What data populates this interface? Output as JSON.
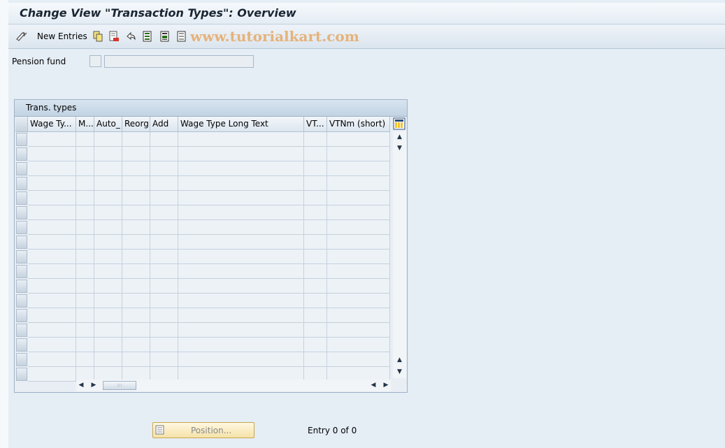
{
  "window": {
    "title": "Change View \"Transaction Types\": Overview"
  },
  "toolbar": {
    "new_entries_label": "New Entries",
    "icons": [
      "display-change-icon",
      "copy-icon",
      "delete-icon",
      "undo-icon",
      "select-all-icon",
      "select-block-icon",
      "deselect-all-icon"
    ],
    "watermark": "www.tutorialkart.com"
  },
  "filter": {
    "pension_fund_label": "Pension fund",
    "pension_fund_key": "",
    "pension_fund_text": ""
  },
  "table": {
    "title": "Trans. types",
    "columns": [
      "Wage Ty...",
      "M...",
      "Auto_",
      "Reorg",
      "Add",
      "Wage Type Long Text",
      "VT...",
      "VTNm (short)"
    ],
    "row_count": 17
  },
  "footer": {
    "position_label": "Position...",
    "entry_text": "Entry 0 of 0"
  },
  "colors": {
    "background": "#e5edf5",
    "accent_button": "#f5e3a8",
    "watermark": "#e6b27a"
  }
}
